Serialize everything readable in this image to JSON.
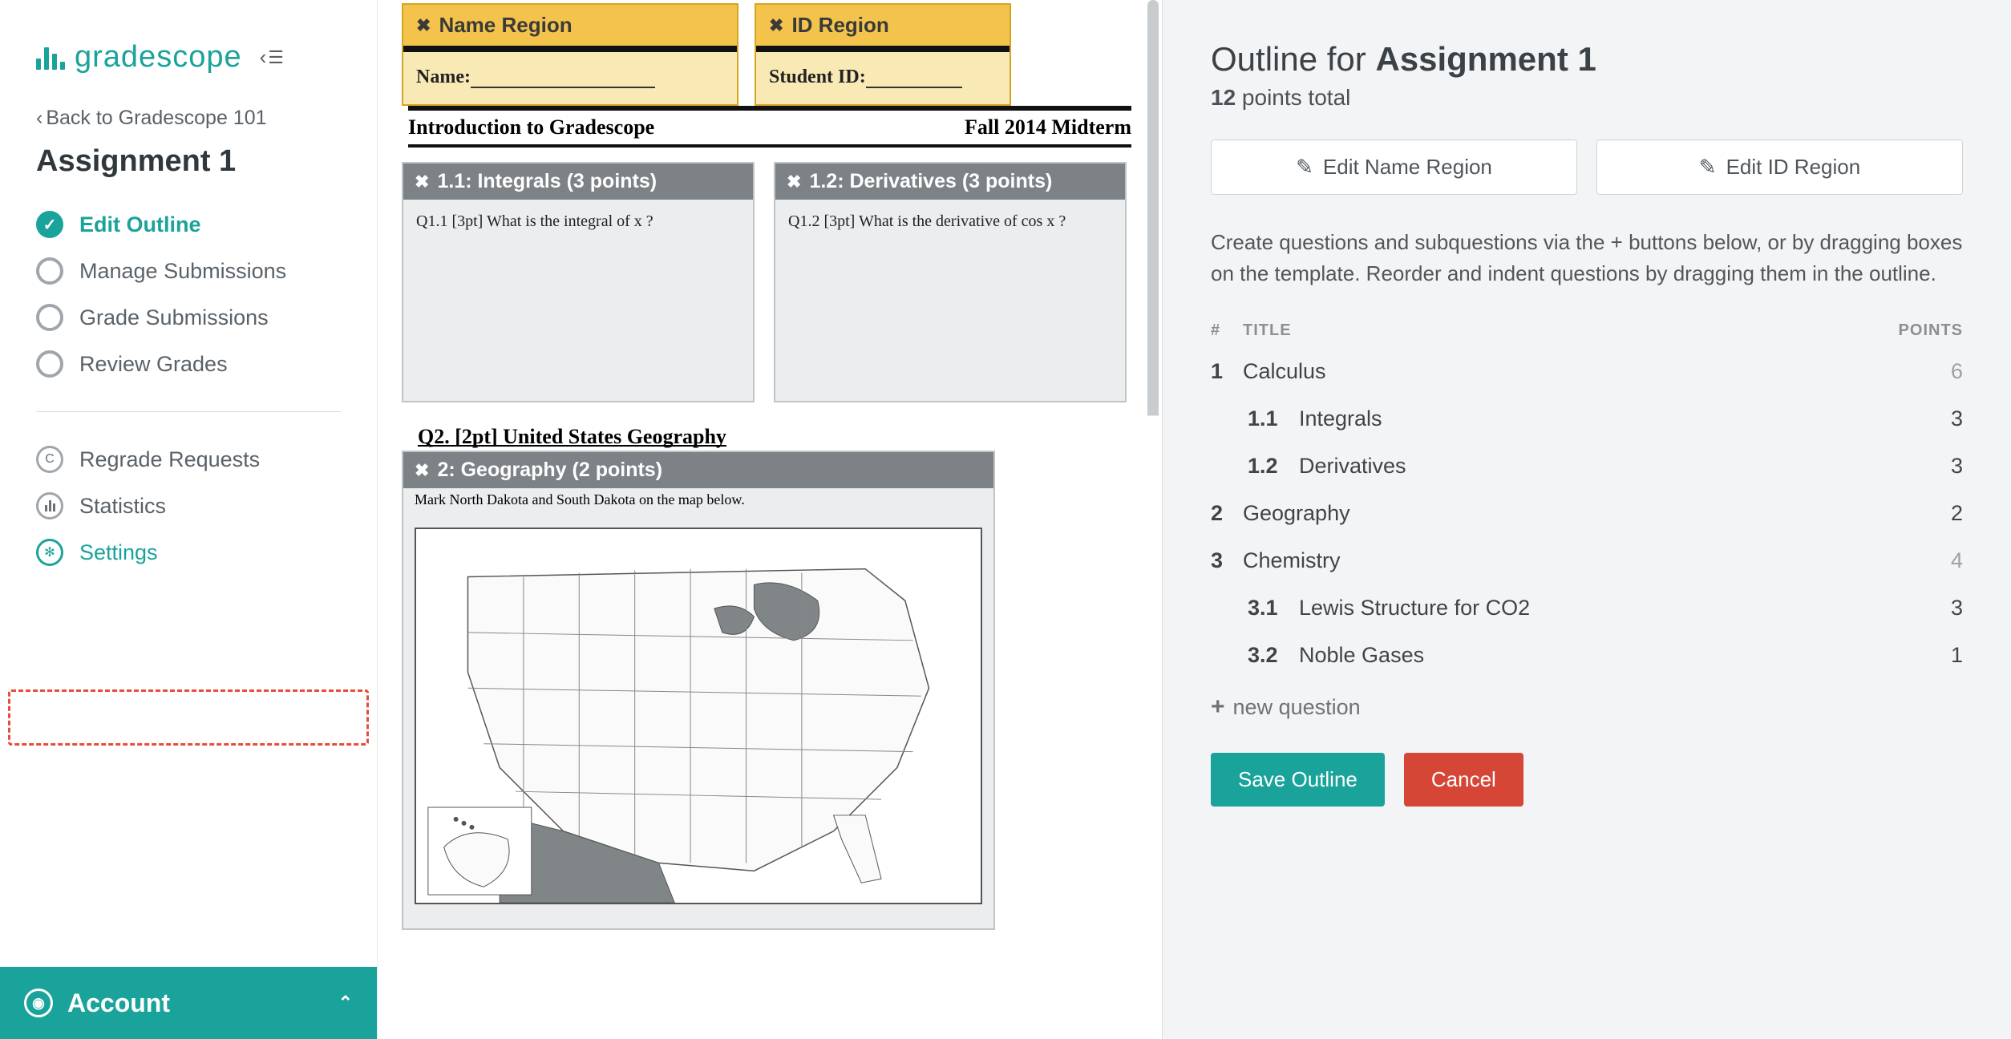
{
  "brand": "gradescope",
  "back_link": "Back to Gradescope 101",
  "assignment_title": "Assignment 1",
  "sidebar": {
    "items": [
      {
        "label": "Edit Outline",
        "active": true
      },
      {
        "label": "Manage Submissions",
        "active": false
      },
      {
        "label": "Grade Submissions",
        "active": false
      },
      {
        "label": "Review Grades",
        "active": false
      }
    ],
    "secondary": [
      {
        "label": "Regrade Requests",
        "glyph": "C"
      },
      {
        "label": "Statistics",
        "glyph": "ılı"
      },
      {
        "label": "Settings",
        "glyph": "✻",
        "highlight": true
      }
    ]
  },
  "account_label": "Account",
  "template": {
    "name_region": {
      "header": "Name Region",
      "label": "Name:"
    },
    "id_region": {
      "header": "ID Region",
      "label": "Student ID:"
    },
    "doc_left": "Introduction to Gradescope",
    "doc_right": "Fall 2014 Midterm",
    "q11": {
      "header": "1.1: Integrals (3 points)",
      "body": "Q1.1  [3pt] What is the integral of x ?"
    },
    "q12": {
      "header": "1.2: Derivatives (3 points)",
      "body": "Q1.2  [3pt]  What is the derivative of  cos x ?"
    },
    "section2": "Q2.  [2pt] United States Geography",
    "q2": {
      "header": "2: Geography (2 points)",
      "desc": "Mark North Dakota and South Dakota on the map below."
    }
  },
  "outline": {
    "heading_prefix": "Outline for ",
    "heading_strong": "Assignment 1",
    "points_num": "12",
    "points_suffix": " points total",
    "edit_name": "Edit Name Region",
    "edit_id": "Edit ID Region",
    "instructions": "Create questions and subquestions via the + buttons below, or by dragging boxes on the template. Reorder and indent questions by dragging them in the outline.",
    "hdr_num": "#",
    "hdr_title": "TITLE",
    "hdr_pts": "POINTS",
    "rows": [
      {
        "num": "1",
        "title": "Calculus",
        "pts": "6",
        "parent": true
      },
      {
        "num": "1.1",
        "title": "Integrals",
        "pts": "3",
        "sub": true
      },
      {
        "num": "1.2",
        "title": "Derivatives",
        "pts": "3",
        "sub": true
      },
      {
        "num": "2",
        "title": "Geography",
        "pts": "2",
        "parent": false
      },
      {
        "num": "3",
        "title": "Chemistry",
        "pts": "4",
        "parent": true
      },
      {
        "num": "3.1",
        "title": "Lewis Structure for CO2",
        "pts": "3",
        "sub": true
      },
      {
        "num": "3.2",
        "title": "Noble Gases",
        "pts": "1",
        "sub": true
      }
    ],
    "add_question": "new question",
    "save": "Save Outline",
    "cancel": "Cancel"
  }
}
